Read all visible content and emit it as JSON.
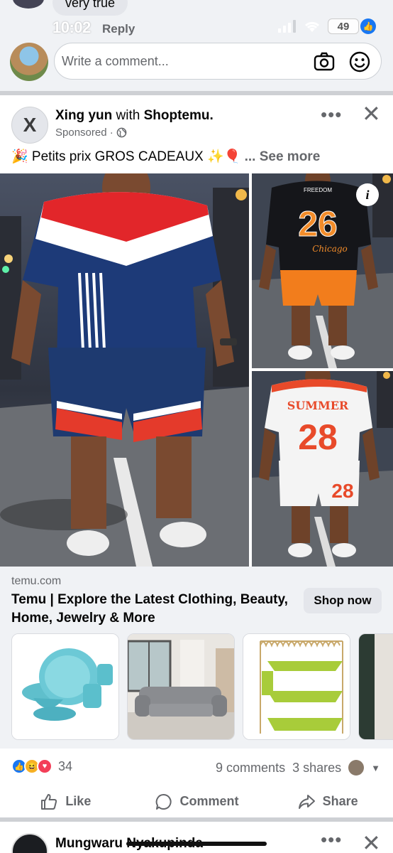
{
  "prev_comment": {
    "text": "very true",
    "reply_label": "Reply"
  },
  "status_bar": {
    "time": "10:02",
    "battery": "49"
  },
  "composer": {
    "placeholder": "Write a comment..."
  },
  "post": {
    "author": "Xing yun",
    "with_word": "with",
    "page": "Shoptemu.",
    "sponsored": "Sponsored ·",
    "caption_prefix": "🎉 Petits prix GROS CADEAUX ✨🎈",
    "see_more": "... See more",
    "avatar_letter": "X",
    "images": [
      {
        "shirt_number": "",
        "desc": "striped red white blue outfit"
      },
      {
        "shirt_top": "FREEDOM",
        "shirt_number": "26",
        "shirt_script": "Chicago"
      },
      {
        "shirt_top": "SUMMER",
        "shirt_number": "28",
        "shorts_number": "28"
      }
    ],
    "link": {
      "domain": "temu.com",
      "title": "Temu | Explore the Latest Clothing, Beauty, Home, Jewelry & More",
      "cta": "Shop now"
    },
    "stats": {
      "reaction_count": "34",
      "comments": "9 comments",
      "shares": "3 shares"
    },
    "actions": {
      "like": "Like",
      "comment": "Comment",
      "share": "Share"
    }
  },
  "next_post": {
    "author": "Mungwaru Nyakupinda"
  },
  "colors": {
    "facebook_blue": "#1877f2",
    "haha_yellow": "#f7b125",
    "love_red": "#f33e58"
  }
}
